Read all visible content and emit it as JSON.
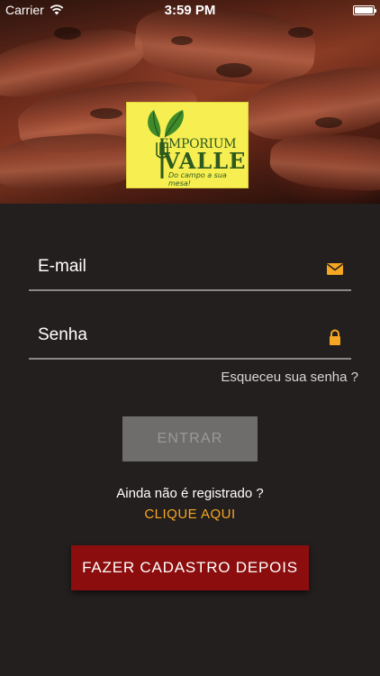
{
  "status_bar": {
    "carrier": "Carrier",
    "time": "3:59 PM",
    "battery_level": 1.0
  },
  "logo": {
    "line1": "EMPORIUM",
    "line2": "VALLE",
    "tagline": "Do campo a sua mesa!"
  },
  "form": {
    "email_placeholder": "E-mail",
    "email_icon": "envelope-icon",
    "password_placeholder": "Senha",
    "password_icon": "lock-icon",
    "forgot_password": "Esqueceu sua senha ?",
    "login_button": "ENTRAR",
    "not_registered": "Ainda não é registrado ?",
    "click_here": "CLIQUE AQUI",
    "register_later_button": "FAZER CADASTRO DEPOIS"
  },
  "colors": {
    "background": "#231f1e",
    "accent": "#f5a623",
    "primary_button": "#8c0d0d",
    "disabled_button": "#6e6d6c",
    "logo_background": "#f7ee52",
    "logo_text": "#2d5a1e"
  }
}
